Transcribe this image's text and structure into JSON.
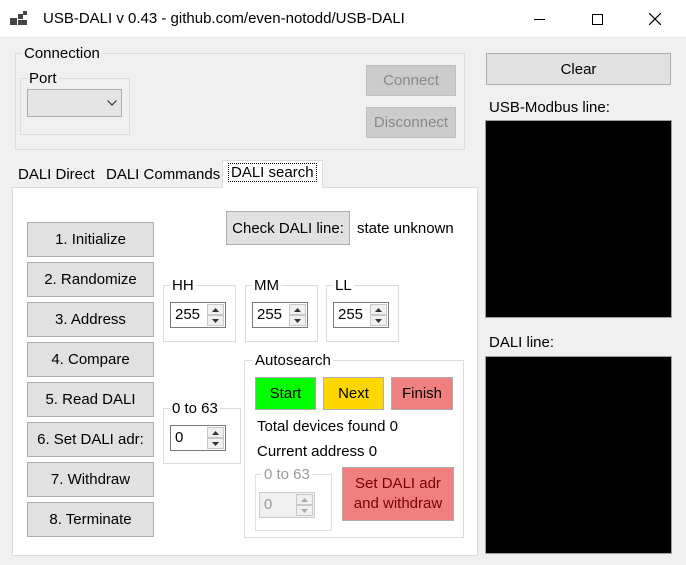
{
  "window": {
    "title": "USB-DALI v 0.43 - github.com/even-notodd/USB-DALI",
    "app_icon": "app-icon",
    "controls": [
      "minimize-icon",
      "maximize-icon",
      "close-icon"
    ]
  },
  "connection": {
    "legend": "Connection",
    "port_legend": "Port",
    "port_value": "",
    "connect_label": "Connect",
    "disconnect_label": "Disconnect"
  },
  "tabs": [
    {
      "label": "DALI Direct",
      "active": false
    },
    {
      "label": "DALI Commands",
      "active": false
    },
    {
      "label": "DALI search",
      "active": true
    }
  ],
  "search": {
    "check_line_label": "Check DALI line:",
    "line_state": "state unknown",
    "steps": [
      "1. Initialize",
      "2. Randomize",
      "3. Address",
      "4. Compare",
      "5. Read DALI",
      "6. Set DALI adr:",
      "7. Withdraw",
      "8. Terminate"
    ],
    "hh": {
      "legend": "HH",
      "value": "255"
    },
    "mm": {
      "legend": "MM",
      "value": "255"
    },
    "ll": {
      "legend": "LL",
      "value": "255"
    },
    "range": {
      "legend": "0 to 63",
      "value": "0"
    }
  },
  "autosearch": {
    "legend": "Autosearch",
    "start_label": "Start",
    "next_label": "Next",
    "finish_label": "Finish",
    "total_found": "Total devices found 0",
    "current_address": "Current address 0",
    "range_legend": "0 to 63",
    "range_value": "0",
    "set_withdraw_label_line1": "Set DALI adr",
    "set_withdraw_label_line2": "and withdraw",
    "colors": {
      "start": "#00ff00",
      "next": "#ffd700",
      "finish": "#f08080"
    }
  },
  "right_panel": {
    "clear_label": "Clear",
    "modbus_label": "USB-Modbus line:",
    "dali_label": "DALI line:"
  }
}
